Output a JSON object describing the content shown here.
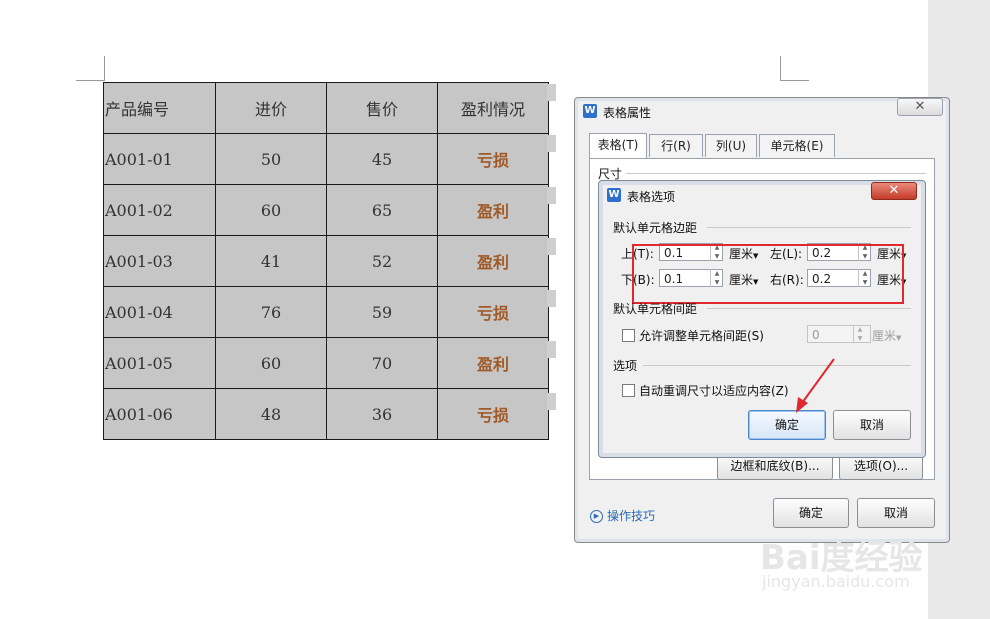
{
  "document": {
    "header": [
      "产品编号",
      "进价",
      "售价",
      "盈利情况"
    ],
    "rows": [
      [
        "A001-01",
        "50",
        "45",
        "亏损"
      ],
      [
        "A001-02",
        "60",
        "65",
        "盈利"
      ],
      [
        "A001-03",
        "41",
        "52",
        "盈利"
      ],
      [
        "A001-04",
        "76",
        "59",
        "亏损"
      ],
      [
        "A001-05",
        "60",
        "70",
        "盈利"
      ],
      [
        "A001-06",
        "48",
        "36",
        "亏损"
      ]
    ]
  },
  "outer_dialog": {
    "title": "表格属性",
    "close_glyph": "✕",
    "tabs": [
      "表格(T)",
      "行(R)",
      "列(U)",
      "单元格(E)"
    ],
    "size_label": "尺寸",
    "borders_button": "边框和底纹(B)...",
    "options_button": "选项(O)...",
    "ok": "确定",
    "cancel": "取消",
    "tips": "操作技巧",
    "tips_icon": "▶"
  },
  "inner_dialog": {
    "title": "表格选项",
    "close_glyph": "✕",
    "default_margins_section": "默认单元格边距",
    "top_label": "上(T):",
    "top_value": "0.1",
    "bottom_label": "下(B):",
    "bottom_value": "0.1",
    "left_label": "左(L):",
    "left_value": "0.2",
    "right_label": "右(R):",
    "right_value": "0.2",
    "unit": "厘米",
    "default_spacing_section": "默认单元格间距",
    "allow_spacing_label": "允许调整单元格间距(S)",
    "spacing_value": "0",
    "options_section": "选项",
    "autofit_label": "自动重调尺寸以适应内容(Z)",
    "ok": "确定",
    "cancel": "取消"
  },
  "colors": {
    "status_text": "#a05a28",
    "highlight": "#e0282e",
    "table_fill": "#c6c6c6"
  },
  "watermark": {
    "logo": "Bai度经验",
    "url": "jingyan.baidu.com"
  }
}
